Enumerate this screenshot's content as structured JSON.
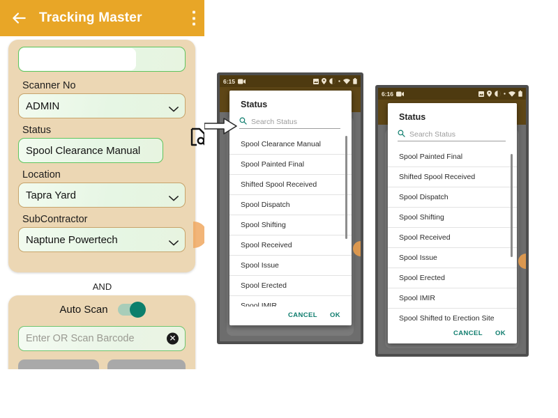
{
  "app": {
    "title": "Tracking Master",
    "back_icon": "back-arrow-icon",
    "overflow_icon": "overflow-menu-icon",
    "accent_color": "#E8A627"
  },
  "form": {
    "fields": [
      {
        "label": "",
        "value": "",
        "type": "masked-input"
      },
      {
        "label": "Scanner No",
        "value": "ADMIN",
        "type": "dropdown"
      },
      {
        "label": "Status",
        "value": "Spool Clearance Manual",
        "type": "picker",
        "trailing_icon": "document-search-icon"
      },
      {
        "label": "Location",
        "value": "Tapra Yard",
        "type": "dropdown"
      },
      {
        "label": "SubContractor",
        "value": "Naptune Powertech",
        "type": "dropdown"
      }
    ],
    "separator_label": "AND",
    "auto_scan_label": "Auto Scan",
    "auto_scan_on": "true",
    "barcode_placeholder": "Enter OR Scan Barcode",
    "barcode_value": "",
    "clear_icon": "clear-circle-icon"
  },
  "phone_1": {
    "status_bar": {
      "time": "6:15",
      "icons": [
        "screen-record-icon",
        "screenshot-icon",
        "location-icon",
        "do-not-disturb-icon",
        "dot-icon",
        "wifi-icon",
        "battery-icon"
      ]
    },
    "dialog": {
      "title": "Status",
      "search_placeholder": "Search Status",
      "search_value": "",
      "search_icon": "search-icon",
      "items": [
        "Spool Clearance Manual",
        "Spool Painted Final",
        "Shifted Spool Received",
        "Spool Dispatch",
        "Spool Shifting",
        "Spool Received",
        "Spool Issue",
        "Spool Erected",
        "Spool IMIR"
      ],
      "cancel_label": "CANCEL",
      "ok_label": "OK"
    }
  },
  "phone_2": {
    "status_bar": {
      "time": "6:16",
      "icons": [
        "screen-record-icon",
        "screenshot-icon",
        "location-icon",
        "do-not-disturb-icon",
        "dot-icon",
        "wifi-icon",
        "battery-icon"
      ]
    },
    "dialog": {
      "title": "Status",
      "search_placeholder": "Search Status",
      "search_value": "",
      "search_icon": "search-icon",
      "items": [
        "Spool Painted Final",
        "Shifted Spool Received",
        "Spool Dispatch",
        "Spool Shifting",
        "Spool Received",
        "Spool Issue",
        "Spool Erected",
        "Spool IMIR",
        "Spool Shifted to Erection Site"
      ],
      "cancel_label": "CANCEL",
      "ok_label": "OK"
    }
  },
  "annotation": {
    "arrow": "pointer-arrow-icon"
  }
}
